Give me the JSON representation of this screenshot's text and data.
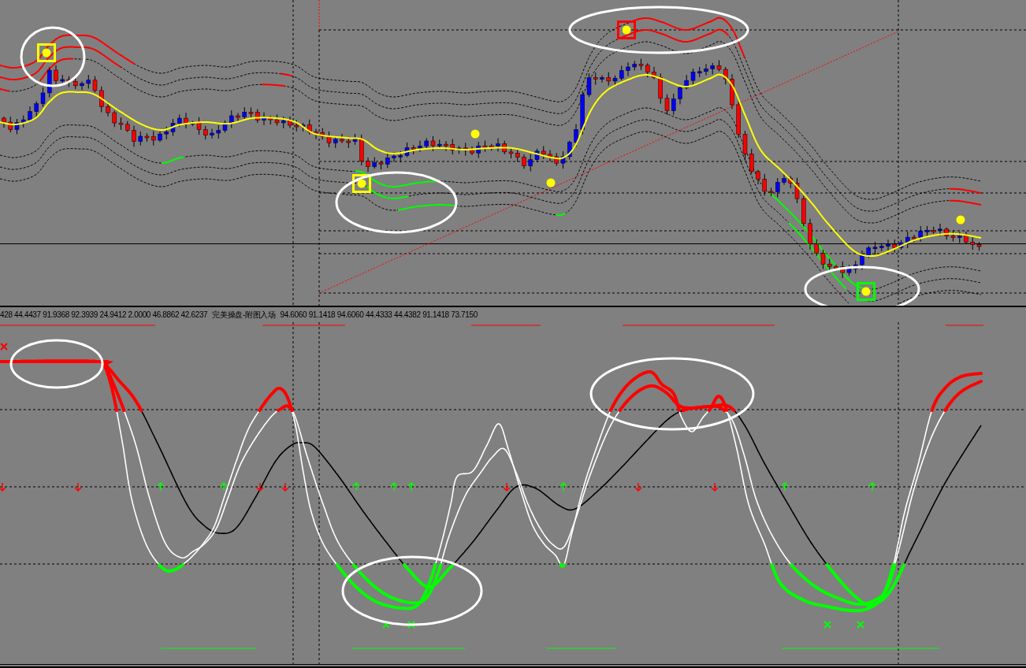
{
  "indicator_header": {
    "values_before": "428 44.4437 91.9368 92.3939 24.9412 2.0000 46.8862 42.6237",
    "name": "完美操盘-附图入场",
    "values_after": "94.6060 91.1418 94.6060 44.4333 44.4382 91.1418 73.7150"
  }
}
